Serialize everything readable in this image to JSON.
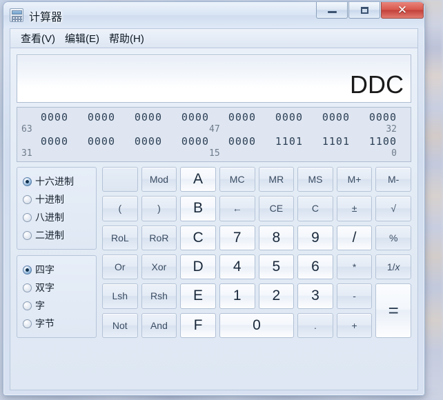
{
  "window": {
    "title": "计算器",
    "icon": "calculator-icon",
    "controls": {
      "minimize": "最小化",
      "maximize": "还原",
      "close": "关闭",
      "close_glyph": "✕"
    }
  },
  "menubar": {
    "items": [
      {
        "label": "查看(V)",
        "name": "menu-view"
      },
      {
        "label": "编辑(E)",
        "name": "menu-edit"
      },
      {
        "label": "帮助(H)",
        "name": "menu-help"
      }
    ]
  },
  "display": {
    "value": "DDC"
  },
  "bit_display": {
    "rows": [
      {
        "groups": [
          "0000",
          "0000",
          "0000",
          "0000",
          "0000",
          "0000",
          "0000",
          "0000"
        ],
        "label_start": "63",
        "label_mid": "47",
        "label_end": "32"
      },
      {
        "groups": [
          "0000",
          "0000",
          "0000",
          "0000",
          "0000",
          "1101",
          "1101",
          "1100"
        ],
        "label_start": "31",
        "label_mid": "15",
        "label_end": "0"
      }
    ]
  },
  "number_base": {
    "options": [
      {
        "label": "十六进制",
        "selected": true
      },
      {
        "label": "十进制",
        "selected": false
      },
      {
        "label": "八进制",
        "selected": false
      },
      {
        "label": "二进制",
        "selected": false
      }
    ]
  },
  "word_size": {
    "options": [
      {
        "label": "四字",
        "selected": true
      },
      {
        "label": "双字",
        "selected": false
      },
      {
        "label": "字",
        "selected": false
      },
      {
        "label": "字节",
        "selected": false
      }
    ]
  },
  "keypad": {
    "keys": [
      {
        "label": "",
        "name": "blank-button",
        "style": "blank"
      },
      {
        "label": "Mod",
        "name": "mod-button",
        "style": "fn"
      },
      {
        "label": "A",
        "name": "hex-a-button",
        "style": "num hex"
      },
      {
        "label": "MC",
        "name": "memory-clear-button",
        "style": "fn"
      },
      {
        "label": "MR",
        "name": "memory-recall-button",
        "style": "fn"
      },
      {
        "label": "MS",
        "name": "memory-store-button",
        "style": "fn"
      },
      {
        "label": "M+",
        "name": "memory-add-button",
        "style": "fn"
      },
      {
        "label": "M-",
        "name": "memory-subtract-button",
        "style": "fn"
      },
      {
        "label": "(",
        "name": "open-paren-button",
        "style": "fn"
      },
      {
        "label": ")",
        "name": "close-paren-button",
        "style": "fn"
      },
      {
        "label": "B",
        "name": "hex-b-button",
        "style": "num hex"
      },
      {
        "label": "←",
        "name": "backspace-button",
        "style": "fn arrow"
      },
      {
        "label": "CE",
        "name": "clear-entry-button",
        "style": "fn"
      },
      {
        "label": "C",
        "name": "clear-button",
        "style": "fn"
      },
      {
        "label": "±",
        "name": "sign-toggle-button",
        "style": "fn"
      },
      {
        "label": "√",
        "name": "square-root-button",
        "style": "fn"
      },
      {
        "label": "RoL",
        "name": "rotate-left-button",
        "style": "fn"
      },
      {
        "label": "RoR",
        "name": "rotate-right-button",
        "style": "fn"
      },
      {
        "label": "C",
        "name": "hex-c-button",
        "style": "num hex"
      },
      {
        "label": "7",
        "name": "digit-7-button",
        "style": "num"
      },
      {
        "label": "8",
        "name": "digit-8-button",
        "style": "num"
      },
      {
        "label": "9",
        "name": "digit-9-button",
        "style": "num"
      },
      {
        "label": "/",
        "name": "divide-button",
        "style": "num"
      },
      {
        "label": "%",
        "name": "percent-button",
        "style": "fn"
      },
      {
        "label": "Or",
        "name": "or-button",
        "style": "fn"
      },
      {
        "label": "Xor",
        "name": "xor-button",
        "style": "fn"
      },
      {
        "label": "D",
        "name": "hex-d-button",
        "style": "num hex"
      },
      {
        "label": "4",
        "name": "digit-4-button",
        "style": "num"
      },
      {
        "label": "5",
        "name": "digit-5-button",
        "style": "num"
      },
      {
        "label": "6",
        "name": "digit-6-button",
        "style": "num"
      },
      {
        "label": "*",
        "name": "multiply-button",
        "style": "fn"
      },
      {
        "label": "1/x",
        "name": "reciprocal-button",
        "style": "fn"
      },
      {
        "label": "Lsh",
        "name": "left-shift-button",
        "style": "fn"
      },
      {
        "label": "Rsh",
        "name": "right-shift-button",
        "style": "fn"
      },
      {
        "label": "E",
        "name": "hex-e-button",
        "style": "num hex"
      },
      {
        "label": "1",
        "name": "digit-1-button",
        "style": "num"
      },
      {
        "label": "2",
        "name": "digit-2-button",
        "style": "num"
      },
      {
        "label": "3",
        "name": "digit-3-button",
        "style": "num"
      },
      {
        "label": "-",
        "name": "subtract-button",
        "style": "fn"
      },
      {
        "label": "=",
        "name": "equals-button",
        "style": "eq"
      },
      {
        "label": "Not",
        "name": "not-button",
        "style": "fn"
      },
      {
        "label": "And",
        "name": "and-button",
        "style": "fn"
      },
      {
        "label": "F",
        "name": "hex-f-button",
        "style": "num hex"
      },
      {
        "label": "0",
        "name": "digit-0-button",
        "style": "num zero"
      },
      {
        "label": ".",
        "name": "decimal-point-button",
        "style": "fn"
      },
      {
        "label": "+",
        "name": "add-button",
        "style": "fn"
      }
    ]
  },
  "colors": {
    "accent": "#4f7aa6",
    "close_button": "#d9584d",
    "bit_text": "#2c3f55",
    "bit_label": "#6e7b8c",
    "panel_bg": "#dfe6f1"
  }
}
